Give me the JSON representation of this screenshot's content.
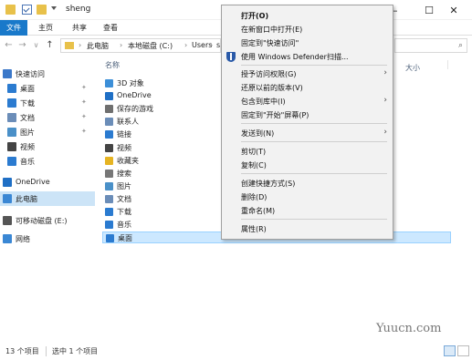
{
  "window": {
    "title": "sheng",
    "minimize_glyph": "—",
    "maximize_glyph": "☐",
    "close_glyph": "✕"
  },
  "ribbon": {
    "tabs": [
      "文件",
      "主页",
      "共享",
      "查看"
    ]
  },
  "address": {
    "back_glyph": "←",
    "forward_glyph": "→",
    "recent_glyph": "∨",
    "up_glyph": "↑",
    "crumbs": [
      "›",
      "此电脑",
      "›",
      "本地磁盘 (C:)",
      "›",
      "Users",
      "›",
      "s"
    ],
    "search_icon": "search-icon",
    "search_glyph": "⌕"
  },
  "nav": {
    "items": [
      {
        "label": "快速访问",
        "icon": "star-icon",
        "color": "#3b78c9",
        "pin": ""
      },
      {
        "label": "桌面",
        "icon": "desktop-icon",
        "color": "#2b7bd0",
        "pin": "✦"
      },
      {
        "label": "下载",
        "icon": "download-icon",
        "color": "#2b7bd0",
        "pin": "✦"
      },
      {
        "label": "文档",
        "icon": "documents-icon",
        "color": "#6b8db8",
        "pin": "✦"
      },
      {
        "label": "图片",
        "icon": "pictures-icon",
        "color": "#4a90c8",
        "pin": "✦"
      },
      {
        "label": "视频",
        "icon": "videos-icon",
        "color": "#444444",
        "pin": ""
      },
      {
        "label": "音乐",
        "icon": "music-icon",
        "color": "#2b7bd0",
        "pin": ""
      },
      {
        "label": "OneDrive",
        "icon": "cloud-icon",
        "color": "#1f6fc5",
        "pin": ""
      },
      {
        "label": "此电脑",
        "icon": "computer-icon",
        "color": "#3a87d4",
        "pin": ""
      },
      {
        "label": "可移动磁盘 (E:)",
        "icon": "removable-drive-icon",
        "color": "#555555",
        "pin": ""
      },
      {
        "label": "网络",
        "icon": "network-icon",
        "color": "#3a87d4",
        "pin": ""
      }
    ]
  },
  "main": {
    "column_name": "名称",
    "column_size": "大小",
    "files": [
      {
        "label": "3D 对象",
        "icon": "cube-icon",
        "color": "#3c8fd8"
      },
      {
        "label": "OneDrive",
        "icon": "cloud-icon",
        "color": "#1f6fc5"
      },
      {
        "label": "保存的游戏",
        "icon": "games-icon",
        "color": "#6f6f6f"
      },
      {
        "label": "联系人",
        "icon": "contacts-icon",
        "color": "#6b8db8"
      },
      {
        "label": "链接",
        "icon": "link-icon",
        "color": "#2b7bd0"
      },
      {
        "label": "视频",
        "icon": "videos-icon",
        "color": "#444444"
      },
      {
        "label": "收藏夹",
        "icon": "star-icon",
        "color": "#e6b422"
      },
      {
        "label": "搜索",
        "icon": "search-icon",
        "color": "#777777"
      },
      {
        "label": "图片",
        "icon": "pictures-icon",
        "color": "#4a90c8"
      },
      {
        "label": "文档",
        "icon": "documents-icon",
        "color": "#6b8db8"
      },
      {
        "label": "下载",
        "icon": "download-icon",
        "color": "#2b7bd0"
      },
      {
        "label": "音乐",
        "icon": "music-icon",
        "color": "#2b7bd0"
      },
      {
        "label": "桌面",
        "icon": "desktop-icon",
        "color": "#2b7bd0"
      }
    ],
    "selected_file": "桌面"
  },
  "context_menu": {
    "items": [
      {
        "label": "打开(O)",
        "bold": true,
        "submenu": false,
        "icon": ""
      },
      {
        "label": "在新窗口中打开(E)",
        "bold": false,
        "submenu": false,
        "icon": ""
      },
      {
        "label": "固定到\"快速访问\"",
        "bold": false,
        "submenu": false,
        "icon": ""
      },
      {
        "label": "使用 Windows Defender扫描...",
        "bold": false,
        "submenu": false,
        "icon": "shield-icon"
      },
      {
        "label": "授予访问权限(G)",
        "bold": false,
        "submenu": true,
        "icon": ""
      },
      {
        "label": "还原以前的版本(V)",
        "bold": false,
        "submenu": false,
        "icon": ""
      },
      {
        "label": "包含到库中(I)",
        "bold": false,
        "submenu": true,
        "icon": ""
      },
      {
        "label": "固定到\"开始\"屏幕(P)",
        "bold": false,
        "submenu": false,
        "icon": ""
      },
      {
        "label": "发送到(N)",
        "bold": false,
        "submenu": true,
        "icon": ""
      },
      {
        "label": "剪切(T)",
        "bold": false,
        "submenu": false,
        "icon": ""
      },
      {
        "label": "复制(C)",
        "bold": false,
        "submenu": false,
        "icon": ""
      },
      {
        "label": "创建快捷方式(S)",
        "bold": false,
        "submenu": false,
        "icon": ""
      },
      {
        "label": "删除(D)",
        "bold": false,
        "submenu": false,
        "icon": ""
      },
      {
        "label": "重命名(M)",
        "bold": false,
        "submenu": false,
        "icon": ""
      },
      {
        "label": "属性(R)",
        "bold": false,
        "submenu": false,
        "icon": ""
      }
    ],
    "submenu_glyph": "›"
  },
  "status": {
    "item_count": "13 个项目",
    "selected": "选中 1 个项目"
  },
  "watermark": "Yuucn.com",
  "colors": {
    "accent": "#1979ca",
    "selection": "#cce8ff",
    "menu_bg": "#f2f2f2"
  }
}
